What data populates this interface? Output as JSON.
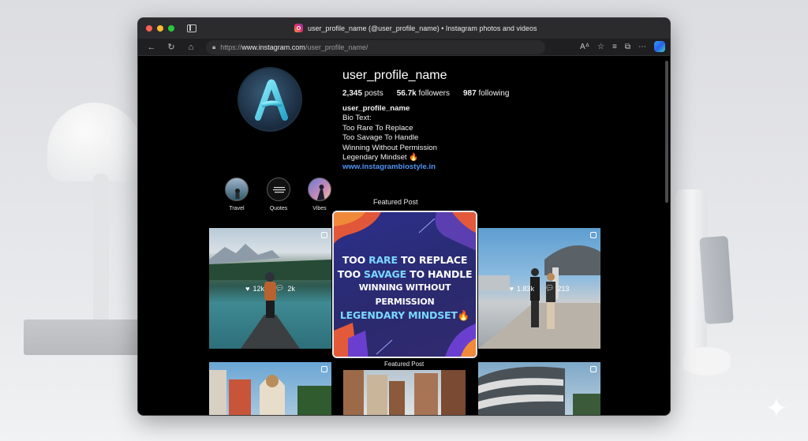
{
  "window": {
    "tab_title": "user_profile_name (@user_profile_name) • Instagram photos and videos",
    "url": {
      "protocol": "https://",
      "host": "www.instagram.com",
      "path": "/user_profile_name/"
    }
  },
  "profile": {
    "avatar_letter": "A",
    "username": "user_profile_name",
    "stats": [
      {
        "value": "2,345",
        "label": "posts"
      },
      {
        "value": "56.7k",
        "label": "followers"
      },
      {
        "value": "987",
        "label": "following"
      }
    ],
    "bio": {
      "name": "user_profile_name",
      "lines": [
        "Bio Text:",
        "Too Rare To Replace",
        "Too Savage To Handle",
        "Winning Without Permission",
        "Legendary Mindset 🔥"
      ],
      "link": "www.instagrambiostyle.in"
    }
  },
  "highlights": [
    {
      "label": "Travel"
    },
    {
      "label": "Quotes"
    },
    {
      "label": "Vibes"
    }
  ],
  "featured": {
    "label_top": "Featured Post",
    "label_bottom": "Featured Post",
    "lines": [
      {
        "pre": "TOO ",
        "accent": "RARE",
        "post": " TO REPLACE"
      },
      {
        "pre": "TOO ",
        "accent": "SAVAGE",
        "post": " TO HANDLE"
      },
      {
        "pre": "WINNING WITHOUT PERMISSION",
        "accent": "",
        "post": ""
      },
      {
        "pre": "",
        "accent": "LEGENDARY MINDSET",
        "post": "🔥"
      }
    ]
  },
  "posts": [
    {
      "likes": "12k",
      "comments": "2k"
    },
    {
      "likes": "1.83k",
      "comments": "213"
    }
  ],
  "colors": {
    "accent_link": "#4f95f5",
    "featured_accent": "#7bd8ff",
    "bg": "#000000"
  }
}
